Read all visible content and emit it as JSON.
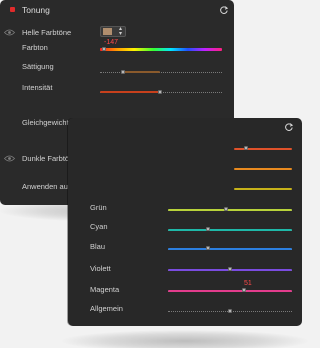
{
  "back": {
    "title": "Tonung",
    "rows": {
      "helle": "Helle Farbtöne",
      "farbton": "Farbton",
      "farbton_value": "-147",
      "saettigung": "Sättigung",
      "intensitaet": "Intensität",
      "gleichgewicht": "Gleichgewicht",
      "dunkle": "Dunkle Farbtöne",
      "anwenden": "Anwenden auf"
    },
    "colors": {
      "highlight_swatch": "#b08e6e",
      "accent_red": "#e12b2b"
    }
  },
  "front": {
    "rows": [
      {
        "label": "Grün",
        "color": "#b8d23a"
      },
      {
        "label": "Cyan",
        "color": "#1fb8a8"
      },
      {
        "label": "Blau",
        "color": "#2c7fe0"
      },
      {
        "label": "Violett",
        "color": "#7a4ce0"
      },
      {
        "label": "Magenta",
        "color": "#e23c8c",
        "value": "51"
      },
      {
        "label": "Allgemein",
        "color": ""
      }
    ]
  }
}
